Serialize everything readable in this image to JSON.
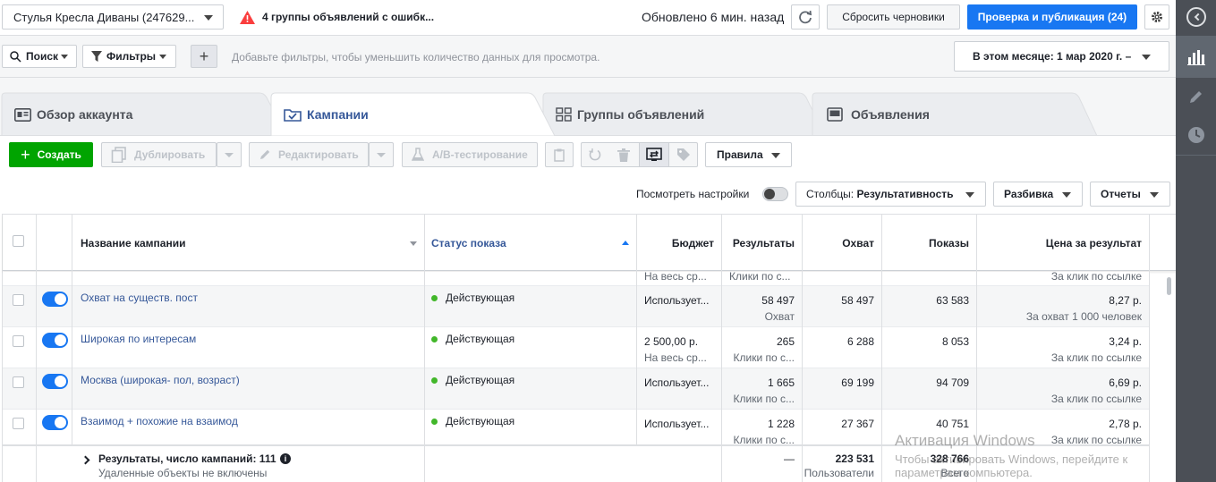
{
  "topbar": {
    "account": "Стулья Кресла Диваны (247629...",
    "error_text": "4 группы объявлений с ошибк...",
    "updated": "Обновлено 6 мин. назад",
    "discard": "Сбросить черновики",
    "publish": "Проверка и публикация (24)"
  },
  "filterbar": {
    "search": "Поиск",
    "filters": "Фильтры",
    "hint": "Добавьте фильтры, чтобы уменьшить количество данных для просмотра.",
    "date_range": "В этом месяце: 1 мар 2020 г. –"
  },
  "tabs": {
    "overview": "Обзор аккаунта",
    "campaigns": "Кампании",
    "adsets": "Группы объявлений",
    "ads": "Объявления"
  },
  "toolbar": {
    "create": "Создать",
    "duplicate": "Дублировать",
    "edit": "Редактировать",
    "ab_test": "A/B-тестирование",
    "rules": "Правила",
    "view_settings": "Посмотреть настройки",
    "columns_label": "Столбцы: ",
    "columns_value": "Результативность",
    "breakdown": "Разбивка",
    "reports": "Отчеты"
  },
  "table": {
    "headers": {
      "name": "Название кампании",
      "status": "Статус показа",
      "budget": "Бюджет",
      "results": "Результаты",
      "reach": "Охват",
      "impressions": "Показы",
      "cost": "Цена за результат"
    },
    "partial_row": {
      "budget_sub": "На весь ср...",
      "results_sub": "Клики по с...",
      "cost_sub": "За клик по ссылке"
    },
    "rows": [
      {
        "name": "Охват на существ. пост",
        "status": "Действующая",
        "budget": "Использует...",
        "budget_sub": "",
        "results": "58 497",
        "results_sub": "Охват",
        "reach": "58 497",
        "impressions": "63 583",
        "cost": "8,27 р.",
        "cost_sub": "За охват 1 000 человек"
      },
      {
        "name": "Широкая по интересам",
        "status": "Действующая",
        "budget": "2 500,00 р.",
        "budget_sub": "На весь ср...",
        "results": "265",
        "results_sub": "Клики по с...",
        "reach": "6 288",
        "impressions": "8 053",
        "cost": "3,24 р.",
        "cost_sub": "За клик по ссылке"
      },
      {
        "name": "Москва (широкая- пол, возраст)",
        "status": "Действующая",
        "budget": "Использует...",
        "budget_sub": "",
        "results": "1 665",
        "results_sub": "Клики по с...",
        "reach": "69 199",
        "impressions": "94 709",
        "cost": "6,69 р.",
        "cost_sub": "За клик по ссылке"
      },
      {
        "name": "Взаимод + похожие на взаимод",
        "status": "Действующая",
        "budget": "Использует...",
        "budget_sub": "",
        "results": "1 228",
        "results_sub": "Клики по с...",
        "reach": "27 367",
        "impressions": "40 751",
        "cost": "2,78 р.",
        "cost_sub": "За клик по ссылке"
      }
    ],
    "footer": {
      "label": "Результаты, число кампаний: 111",
      "sub": "Удаленные объекты не включены",
      "results": "—",
      "reach": "223 531",
      "reach_sub": "Пользователи",
      "impressions": "328 766",
      "impressions_sub": "Всего"
    }
  },
  "watermark": {
    "line1": "Активация Windows",
    "line2": "Чтобы активировать Windows, перейдите к",
    "line3": "параметрам компьютера."
  },
  "colors": {
    "accent": "#1877f2",
    "create": "#00a400",
    "error": "#fa3e3e",
    "status": "#42b72a",
    "sidebar": "#4b4f56"
  }
}
